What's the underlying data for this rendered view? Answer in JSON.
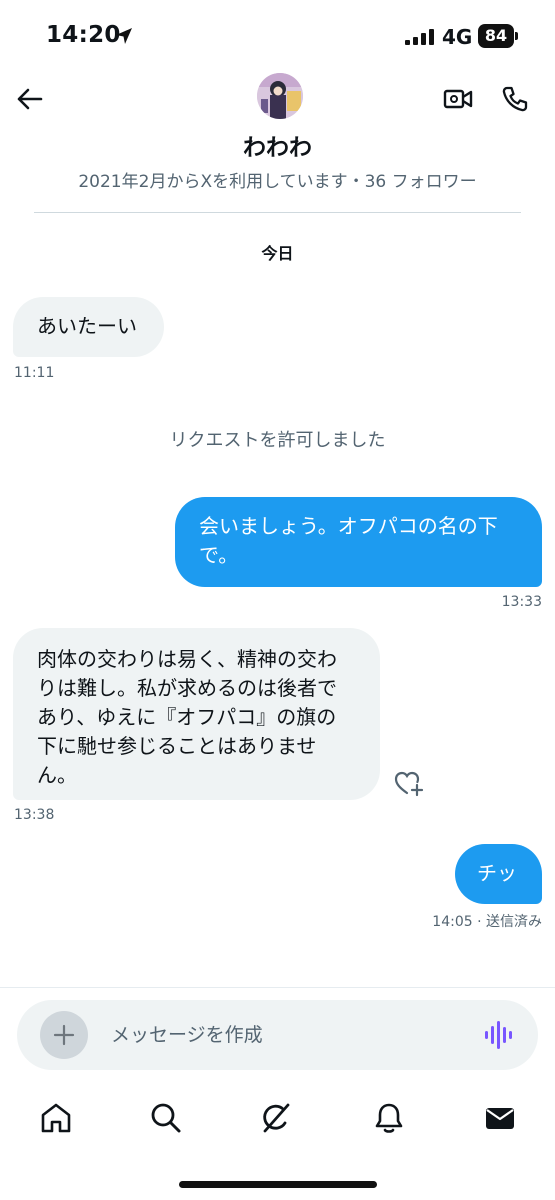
{
  "status_bar": {
    "time": "14:20",
    "network": "4G",
    "battery": "84",
    "icons": [
      "location-arrow-icon",
      "signal-bars-icon",
      "battery-icon"
    ]
  },
  "header": {
    "display_name": "わわわ",
    "meta": "2021年2月からXを利用しています・36 フォロワー",
    "icons": [
      "back-arrow-icon",
      "video-camera-icon",
      "phone-icon"
    ]
  },
  "conversation": {
    "date_label": "今日",
    "system_note": "リクエストを許可しました",
    "messages": [
      {
        "direction": "incoming",
        "text": "あいたーい",
        "time": "11:11"
      },
      {
        "direction": "outgoing",
        "lines": [
          "会いましょう。オフパコの名の下",
          "で。"
        ],
        "time": "13:33"
      },
      {
        "direction": "incoming",
        "lines": [
          "肉体の交わりは易く、精神の交わ",
          "りは難し。私が求めるのは後者で",
          "あり、ゆえに『オフパコ』の旗の",
          "下に馳せ参じることはありませ",
          "ん。"
        ],
        "time": "13:38"
      },
      {
        "direction": "outgoing",
        "text": "チッ",
        "time": "14:05 · 送信済み"
      }
    ]
  },
  "composer": {
    "placeholder": "メッセージを作成",
    "icons": [
      "plus-icon",
      "voice-wave-icon"
    ]
  },
  "bottom_nav": {
    "items": [
      "home-icon",
      "search-icon",
      "grok-icon",
      "bell-icon",
      "mail-icon"
    ]
  },
  "colors": {
    "accent": "#1d9bf0",
    "incoming_bubble": "#eff3f4",
    "secondary_text": "#536471",
    "voice_icon": "#7856ff"
  }
}
